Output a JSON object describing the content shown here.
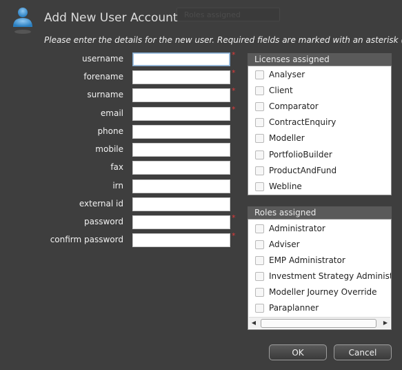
{
  "dialog": {
    "title": "Add New User Account",
    "background_field_text": "Roles assigned",
    "instructions": "Please enter the details for the new user. Required fields are marked with an asterisk (*).",
    "required_mark": "*"
  },
  "fields": [
    {
      "label": "username",
      "value": "",
      "required": true
    },
    {
      "label": "forename",
      "value": "",
      "required": true
    },
    {
      "label": "surname",
      "value": "",
      "required": true
    },
    {
      "label": "email",
      "value": "",
      "required": true
    },
    {
      "label": "phone",
      "value": "",
      "required": false
    },
    {
      "label": "mobile",
      "value": "",
      "required": false
    },
    {
      "label": "fax",
      "value": "",
      "required": false
    },
    {
      "label": "irn",
      "value": "",
      "required": false
    },
    {
      "label": "external id",
      "value": "",
      "required": false
    },
    {
      "label": "password",
      "value": "",
      "required": true
    },
    {
      "label": "confirm password",
      "value": "",
      "required": true
    }
  ],
  "licenses": {
    "header": "Licenses assigned",
    "items": [
      {
        "label": "Analyser",
        "checked": false
      },
      {
        "label": "Client",
        "checked": false
      },
      {
        "label": "Comparator",
        "checked": false
      },
      {
        "label": "ContractEnquiry",
        "checked": false
      },
      {
        "label": "Modeller",
        "checked": false
      },
      {
        "label": "PortfolioBuilder",
        "checked": false
      },
      {
        "label": "ProductAndFund",
        "checked": false
      },
      {
        "label": "Webline",
        "checked": false
      }
    ]
  },
  "roles": {
    "header": "Roles assigned",
    "items": [
      {
        "label": "Administrator",
        "checked": false
      },
      {
        "label": "Adviser",
        "checked": false
      },
      {
        "label": "EMP Administrator",
        "checked": false
      },
      {
        "label": "Investment Strategy Administrator",
        "checked": false
      },
      {
        "label": "Modeller Journey Override",
        "checked": false
      },
      {
        "label": "Paraplanner",
        "checked": false
      }
    ]
  },
  "buttons": {
    "ok": "OK",
    "cancel": "Cancel"
  },
  "colors": {
    "required_mark": "#e23b3b",
    "dialog_bg": "#3e3e3e",
    "header_bg": "#5a5a5a"
  }
}
